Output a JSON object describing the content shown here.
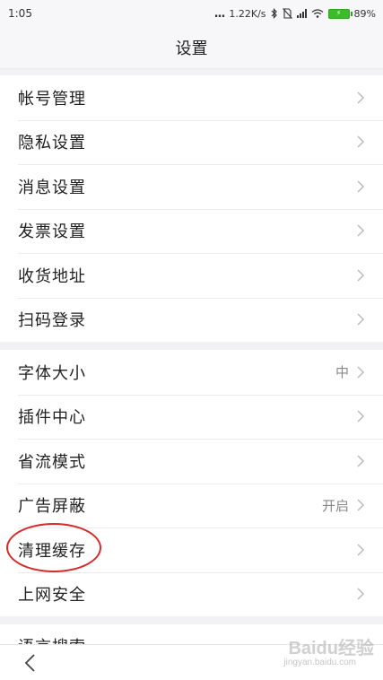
{
  "status_bar": {
    "time": "1:05",
    "dots": "...",
    "speed": "1.22K/s",
    "battery": "89%"
  },
  "title": "设置",
  "groups": [
    {
      "items": [
        {
          "label": "帐号管理"
        },
        {
          "label": "隐私设置"
        },
        {
          "label": "消息设置"
        },
        {
          "label": "发票设置"
        },
        {
          "label": "收货地址"
        },
        {
          "label": "扫码登录"
        }
      ]
    },
    {
      "items": [
        {
          "label": "字体大小",
          "value": "中"
        },
        {
          "label": "插件中心"
        },
        {
          "label": "省流模式"
        },
        {
          "label": "广告屏蔽",
          "value": "开启"
        },
        {
          "label": "清理缓存"
        },
        {
          "label": "上网安全"
        }
      ]
    }
  ],
  "partial_item": {
    "label": "语言搜索"
  },
  "watermark": {
    "text": "Baidu经验",
    "sub": "jingyan.baidu.com"
  },
  "colors": {
    "highlight": "#d62a2a",
    "battery": "#3dbb2a"
  }
}
